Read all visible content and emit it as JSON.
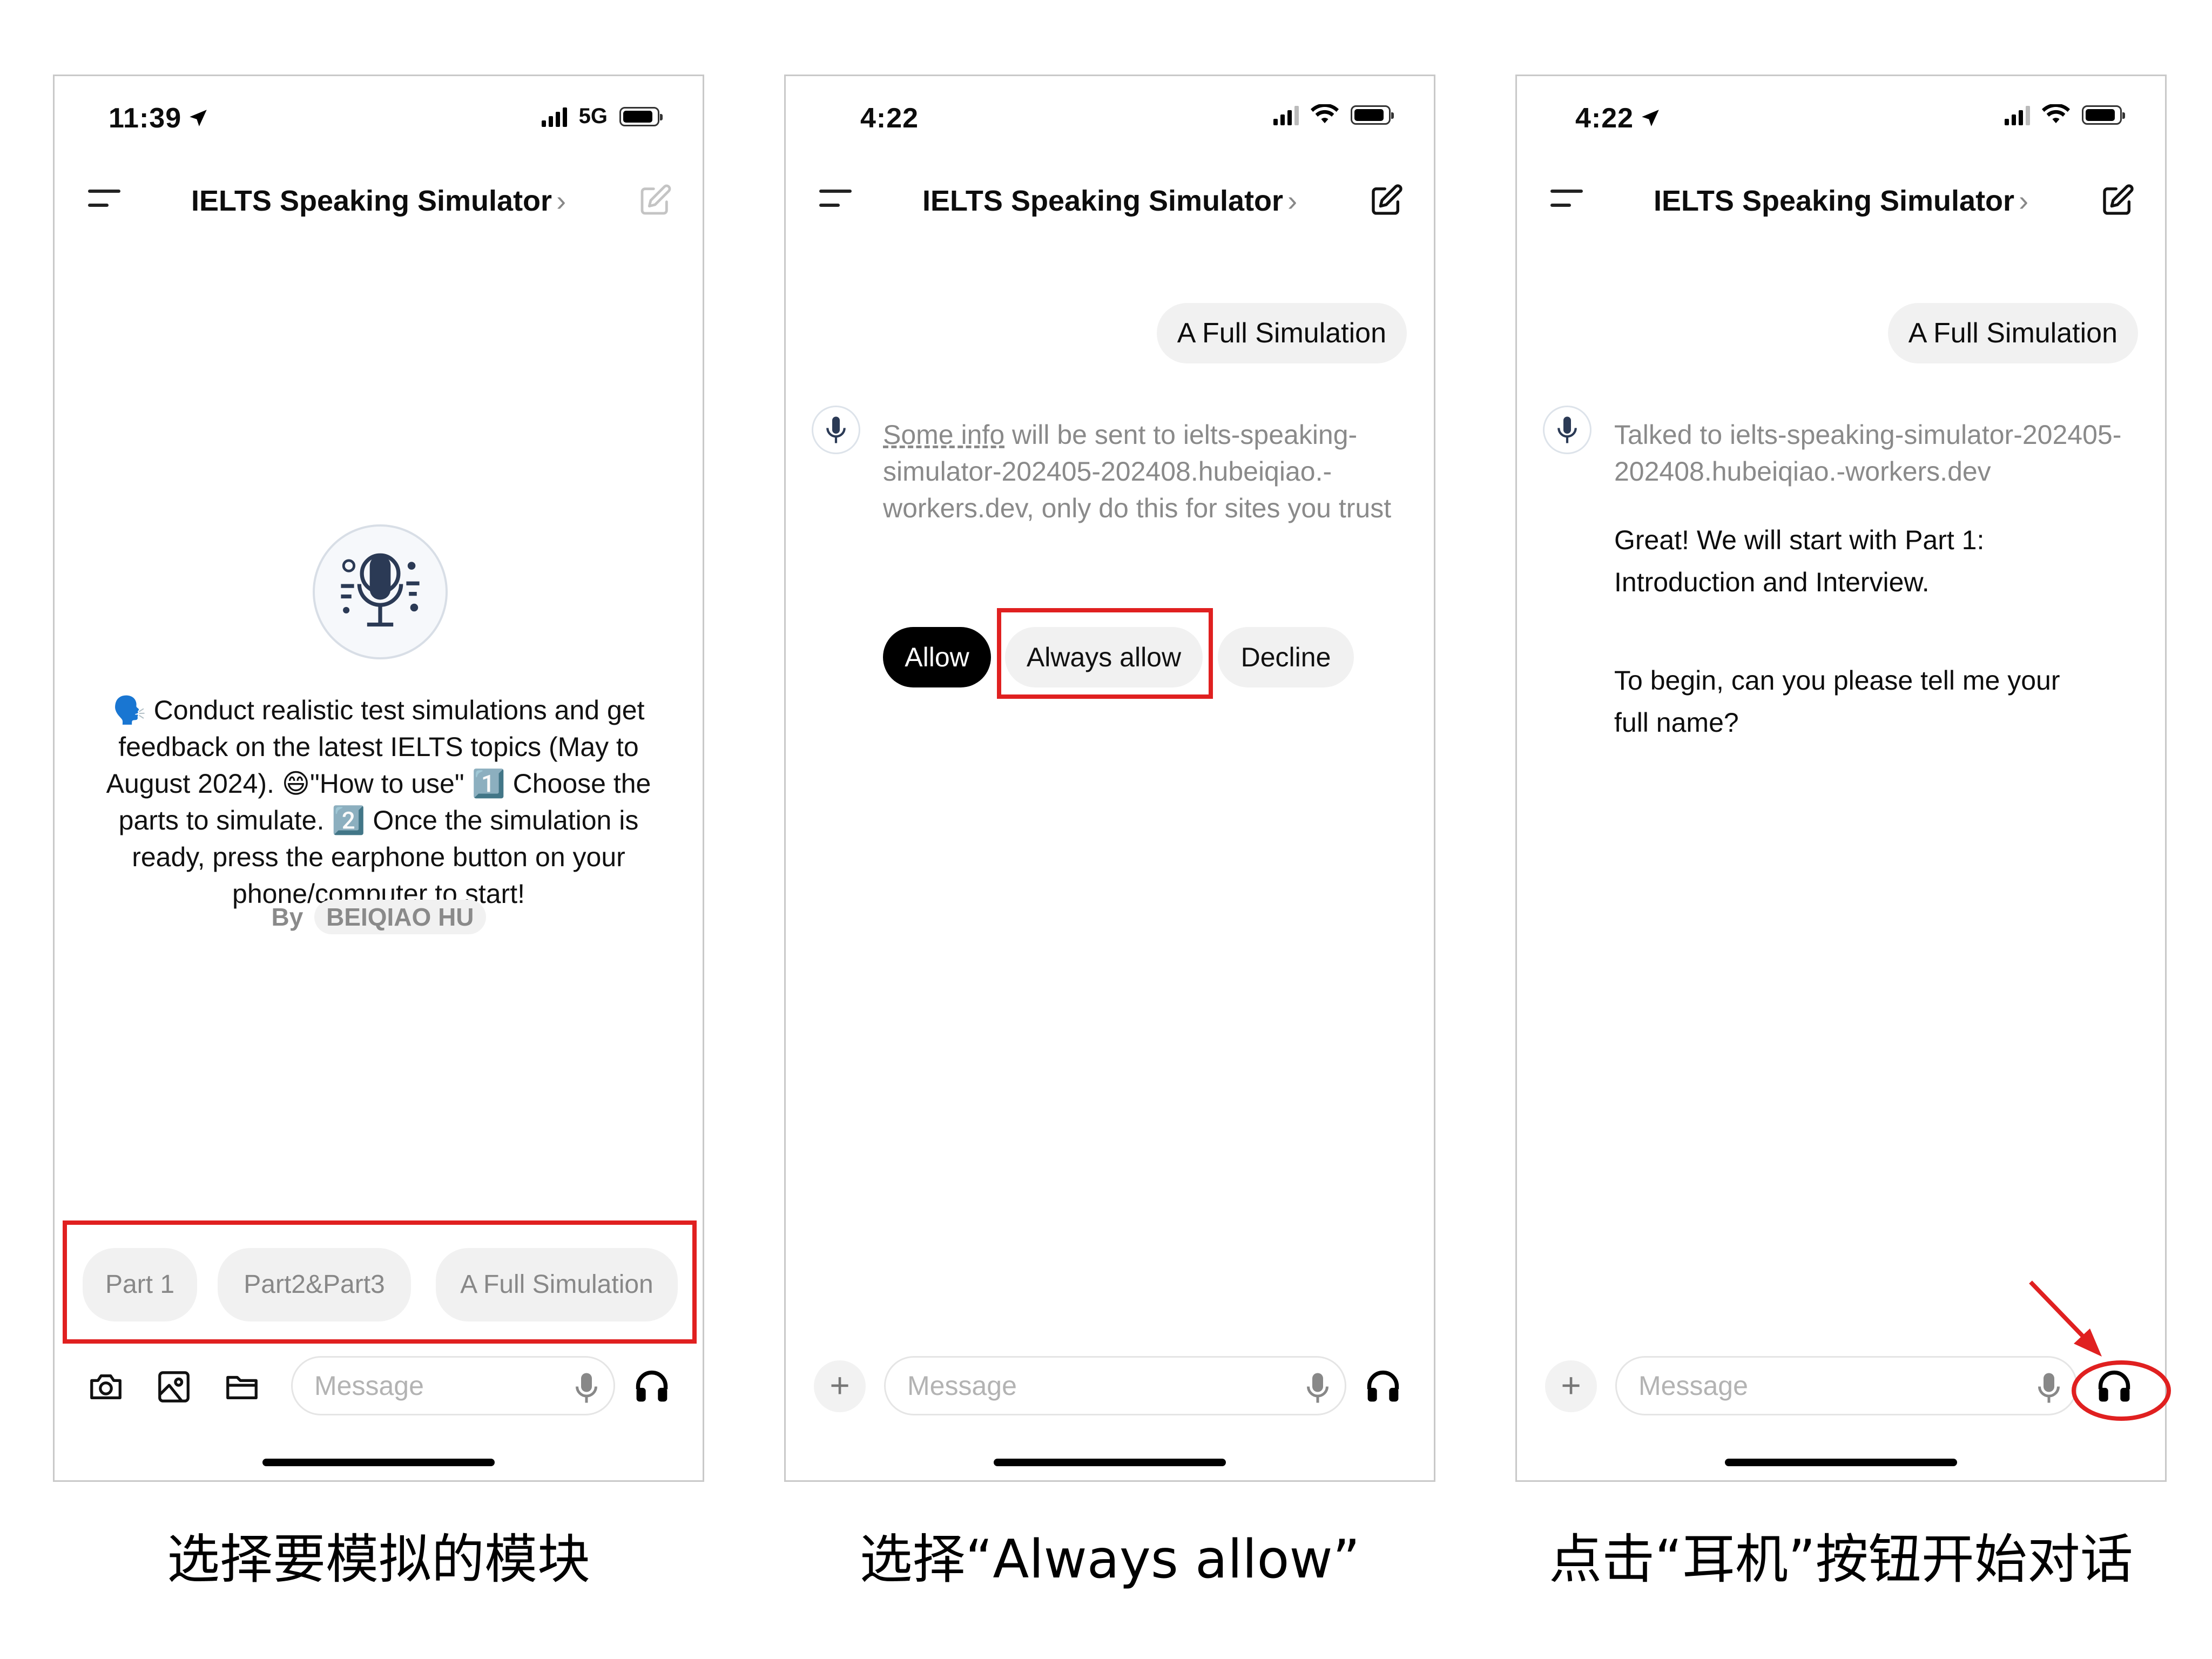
{
  "screens": [
    {
      "status": {
        "time": "11:39",
        "network": "5G"
      },
      "header": {
        "title": "IELTS Speaking Simulator"
      },
      "intro": {
        "description": "🗣️ Conduct realistic test simulations and get feedback on the latest IELTS topics (May to August 2024). 😄\"How to use\" 1️⃣ Choose the parts to simulate. 2️⃣ Once the simulation is ready, press the earphone button on your phone/computer to start!",
        "by_label": "By",
        "author": "BEIQIAO HU"
      },
      "suggestions": [
        "Part 1",
        "Part2&Part3",
        "A Full Simulation"
      ],
      "input": {
        "placeholder": "Message"
      },
      "caption": "选择要模拟的模块"
    },
    {
      "status": {
        "time": "4:22"
      },
      "header": {
        "title": "IELTS Speaking Simulator"
      },
      "user_message": "A Full Simulation",
      "notice": {
        "link": "Some info",
        "text": " will be sent to ielts-speaking-simulator-202405-202408.hubeiqiao.-workers.dev, only do this for sites you trust"
      },
      "actions": {
        "allow": "Allow",
        "always_allow": "Always allow",
        "decline": "Decline"
      },
      "input": {
        "placeholder": "Message"
      },
      "caption": "选择“Always allow”"
    },
    {
      "status": {
        "time": "4:22"
      },
      "header": {
        "title": "IELTS Speaking Simulator"
      },
      "user_message": "A Full Simulation",
      "talked": "Talked to ielts-speaking-simulator-202405-202408.hubeiqiao.-workers.dev",
      "reply_1": "Great! We will start with Part 1: Introduction and Interview.",
      "reply_2": "To begin, can you please tell me your full name?",
      "input": {
        "placeholder": "Message"
      },
      "caption": "点击“耳机”按钮开始对话"
    }
  ],
  "colors": {
    "highlight": "#e02020",
    "allow_bg": "#000000",
    "pill_bg": "#f1f1f1"
  },
  "icons": [
    "location-arrow-icon",
    "signal-icon",
    "wifi-icon",
    "battery-icon",
    "menu-icon",
    "chevron-right-icon",
    "edit-icon",
    "camera-icon",
    "image-icon",
    "folder-icon",
    "mic-icon",
    "headphones-icon",
    "plus-icon",
    "bot-avatar-icon",
    "red-arrow-icon"
  ]
}
